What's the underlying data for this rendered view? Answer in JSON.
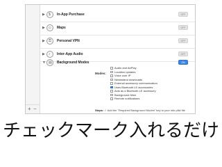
{
  "sidebar": {
    "add_label": "+",
    "remove_label": "−"
  },
  "capabilities": [
    {
      "title": "In-App Purchase",
      "toggle": "OFF",
      "on": false
    },
    {
      "title": "Maps",
      "toggle": "OFF",
      "on": false
    },
    {
      "title": "Personal VPN",
      "toggle": "OFF",
      "on": false
    },
    {
      "title": "Inter-App Audio",
      "toggle": "OFF",
      "on": false
    },
    {
      "title": "Background Modes",
      "toggle": "ON",
      "on": true
    }
  ],
  "background_modes": {
    "label": "Modes:",
    "items": [
      {
        "label": "Audio and AirPlay",
        "checked": false
      },
      {
        "label": "Location updates",
        "checked": false
      },
      {
        "label": "Voice over IP",
        "checked": false
      },
      {
        "label": "Newsstand downloads",
        "checked": false
      },
      {
        "label": "External accessory communication",
        "checked": false
      },
      {
        "label": "Uses Bluetooth LE accessories",
        "checked": true
      },
      {
        "label": "Acts as a Bluetooth LE accessory",
        "checked": false
      },
      {
        "label": "Background fetch",
        "checked": false
      },
      {
        "label": "Remote notifications",
        "checked": false
      }
    ]
  },
  "steps": {
    "label": "Steps:",
    "text": "✓ Add the \"Required Background Modes\" key to your info plist file"
  },
  "caption": "チェックマーク入れるだけ"
}
